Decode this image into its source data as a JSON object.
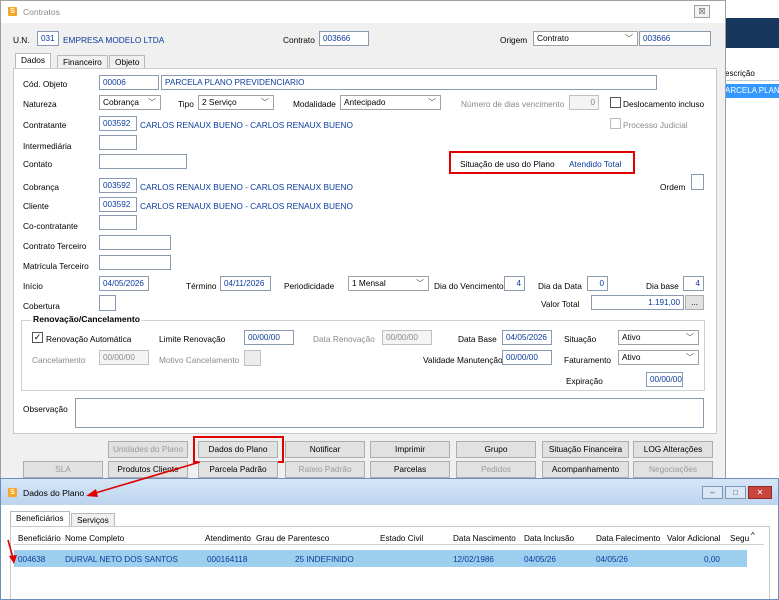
{
  "bg_window": {
    "column_header": "escrição",
    "row_value": "ARCELA PLANO"
  },
  "contratos": {
    "title": "Contratos",
    "close_symbol": "☒",
    "un": {
      "label": "U.N.",
      "code": "031",
      "name": "EMPRESA MODELO LTDA"
    },
    "contrato": {
      "label": "Contrato",
      "value": "003666"
    },
    "origem": {
      "label": "Origem",
      "value": "Contrato",
      "code": "003666"
    },
    "tabs": [
      "Dados",
      "Financeiro",
      "Objeto"
    ],
    "fields": {
      "cod_objeto": {
        "label": "Cód. Objeto",
        "code": "00006",
        "desc": "PARCELA PLANO PREVIDENCIARIO"
      },
      "natureza": {
        "label": "Natureza",
        "value": "Cobrança"
      },
      "tipo": {
        "label": "Tipo",
        "value": "2 Serviço"
      },
      "modalidade": {
        "label": "Modalidade",
        "value": "Antecipado"
      },
      "num_dias": {
        "label": "Número de dias vencimento",
        "value": "0"
      },
      "deslocamento": {
        "label": "Deslocamento incluso",
        "checked": false
      },
      "contratante": {
        "label": "Contratante",
        "code": "003592",
        "name": "CARLOS RENAUX BUENO - CARLOS RENAUX BUENO"
      },
      "processo_judicial": {
        "label": "Processo Judicial",
        "checked": false
      },
      "intermediaria": {
        "label": "Intermediária",
        "value": ""
      },
      "contato": {
        "label": "Contato",
        "value": ""
      },
      "situacao_uso": {
        "label": "Situação de uso do Plano",
        "value": "Atendido Total"
      },
      "cobranca": {
        "label": "Cobrança",
        "code": "003592",
        "name": "CARLOS RENAUX BUENO - CARLOS RENAUX BUENO"
      },
      "ordem": {
        "label": "Ordem",
        "value": ""
      },
      "cliente": {
        "label": "Cliente",
        "code": "003592",
        "name": "CARLOS RENAUX BUENO - CARLOS RENAUX BUENO"
      },
      "co_contratante": {
        "label": "Co-contratante",
        "value": ""
      },
      "contrato_terceiro": {
        "label": "Contrato Terceiro",
        "value": ""
      },
      "matricula_terceiro": {
        "label": "Matrícula Terceiro",
        "value": ""
      },
      "inicio": {
        "label": "Início",
        "value": "04/05/2026"
      },
      "termino": {
        "label": "Término",
        "value": "04/11/2026"
      },
      "periodicidade": {
        "label": "Periodicidade",
        "value": "1 Mensal"
      },
      "dia_vencimento": {
        "label": "Dia do Vencimento",
        "value": "4"
      },
      "dia_data": {
        "label": "Dia da Data",
        "value": "0"
      },
      "dia_base": {
        "label": "Dia base",
        "value": "4"
      },
      "cobertura": {
        "label": "Cobertura",
        "value": ""
      },
      "valor_total": {
        "label": "Valor Total",
        "value": "1.191,00",
        "button": "..."
      }
    },
    "renovacao": {
      "title": "Renovação/Cancelamento",
      "auto": {
        "label": "Renovação Automática",
        "checked": true,
        "mark": "✓"
      },
      "limite": {
        "label": "Limite Renovação",
        "value": "00/00/00"
      },
      "data_renovacao": {
        "label": "Data Renovação",
        "value": "00/00/00"
      },
      "data_base": {
        "label": "Data Base",
        "value": "04/05/2026"
      },
      "situacao": {
        "label": "Situação",
        "value": "Ativo"
      },
      "cancelamento": {
        "label": "Cancelamento",
        "value": "00/00/00"
      },
      "motivo": {
        "label": "Motivo Cancelamento",
        "value": ""
      },
      "validade": {
        "label": "Validade Manutenção",
        "value": "00/00/00"
      },
      "faturamento": {
        "label": "Faturamento",
        "value": "Ativo"
      },
      "expiracao": {
        "label": "Expiração",
        "value": "00/00/00"
      }
    },
    "observacao": {
      "label": "Observação",
      "value": ""
    },
    "buttons_row1": [
      "Unidades do Plano",
      "Dados do Plano",
      "Notificar",
      "Imprimir",
      "Grupo",
      "Situação Financeira",
      "LOG Alterações"
    ],
    "buttons_row2": [
      "SLA",
      "Produtos Cliente",
      "Parcela Padrão",
      "Rateio Padrão",
      "Parcelas",
      "Pedidos",
      "Acompanhamento",
      "Negociações"
    ]
  },
  "dados_plano": {
    "title": "Dados do Plano",
    "window_buttons": [
      "–",
      "□",
      "✕"
    ],
    "tabs": [
      "Beneficiários",
      "Serviços"
    ],
    "columns": [
      "Beneficiário",
      "Nome Completo",
      "Atendimento",
      "Grau de Parentesco",
      "Estado Civil",
      "Data Nascimento",
      "Data Inclusão",
      "Data Falecimento",
      "Valor Adicional",
      "Segu"
    ],
    "rows": [
      {
        "beneficiario": "004638",
        "nome": "DURVAL NETO DOS SANTOS",
        "atendimento": "000164118",
        "grau": "25 INDEFINIDO",
        "estado_civil": "",
        "nascimento": "12/02/1986",
        "inclusao": "04/05/26",
        "falecimento": "04/05/26",
        "valor": "0,00",
        "segu": ""
      }
    ]
  },
  "colors": {
    "highlight_red": "#e00000",
    "selection_blue": "#9ccfee",
    "text_blue": "#0b3b9c"
  }
}
